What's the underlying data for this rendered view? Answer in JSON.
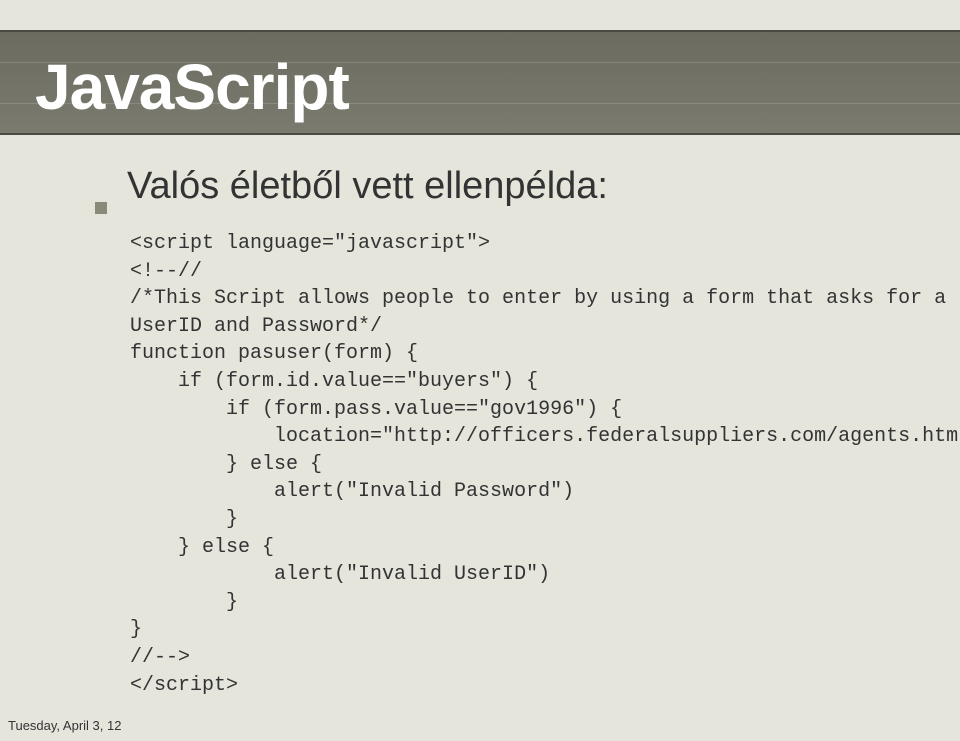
{
  "title": "JavaScript",
  "bullet": "Valós életből vett ellenpélda:",
  "code": {
    "l1": "<script language=\"javascript\">",
    "l2": "<!--//",
    "l3": "/*This Script allows people to enter by using a form that asks for a",
    "l4": "UserID and Password*/",
    "l5": "function pasuser(form) {",
    "l6": "    if (form.id.value==\"buyers\") {",
    "l7": "        if (form.pass.value==\"gov1996\") {",
    "l8": "            location=\"http://officers.federalsuppliers.com/agents.html\"",
    "l9": "        } else {",
    "l10": "            alert(\"Invalid Password\")",
    "l11": "        }",
    "l12": "    } else {",
    "l13": "            alert(\"Invalid UserID\")",
    "l14": "        }",
    "l15": "}",
    "l16": "//-->",
    "l17": "</script>"
  },
  "footer": "Tuesday, April 3, 12"
}
